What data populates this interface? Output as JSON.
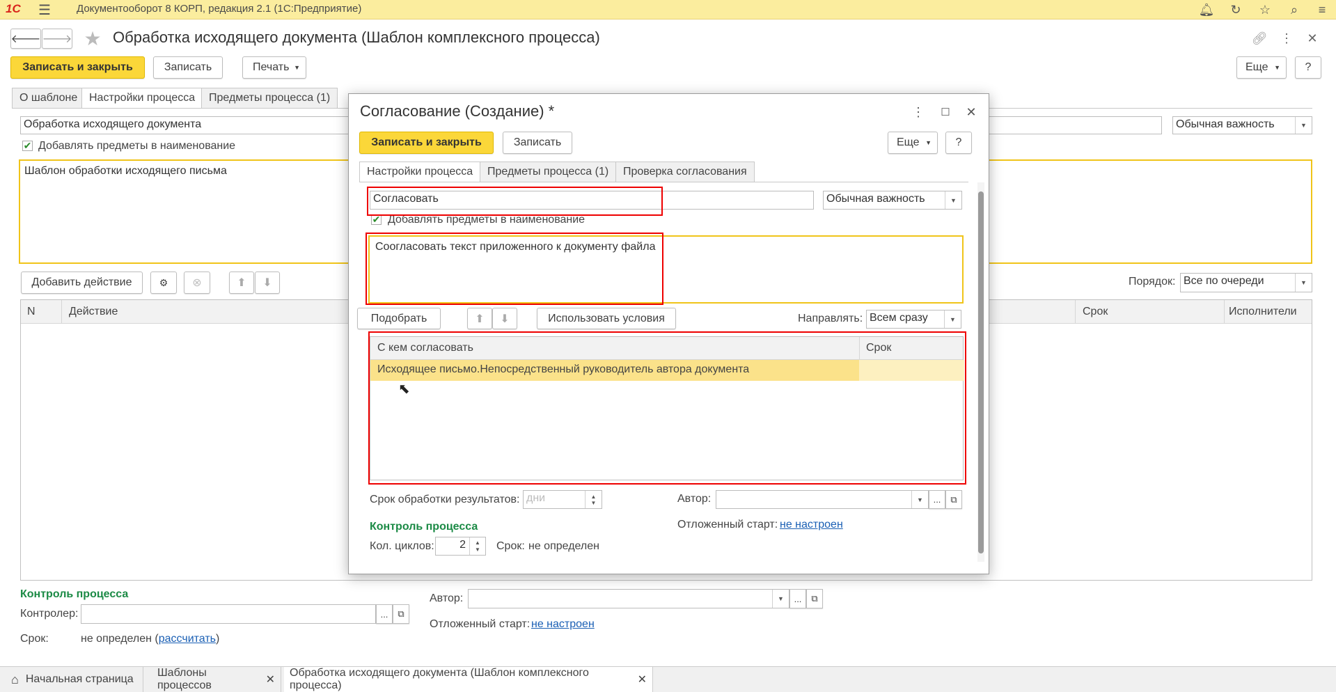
{
  "app": {
    "title": "Документооборот 8 КОРП, редакция 2.1  (1С:Предприятие)",
    "logo": "1С"
  },
  "main": {
    "title": "Обработка исходящего документа (Шаблон комплексного процесса)",
    "btn_save_close": "Записать и закрыть",
    "btn_save": "Записать",
    "btn_print": "Печать",
    "btn_more": "Еще",
    "btn_help": "?",
    "tabs": [
      "О шаблоне",
      "Настройки процесса",
      "Предметы процесса (1)"
    ],
    "name_value": "Обработка исходящего документа",
    "importance": "Обычная важность",
    "add_subjects_label": "Добавлять предметы в наименование",
    "description": "Шаблон обработки исходящего письма",
    "btn_add_action": "Добавить действие",
    "order_label": "Порядок:",
    "order_value": "Все по очереди",
    "table_headers": [
      "N",
      "Действие",
      "Срок",
      "Исполнители"
    ],
    "control_title": "Контроль процесса",
    "controller_label": "Контролер:",
    "term_label": "Срок:",
    "term_value": "не определен (",
    "term_link": "рассчитать",
    "term_close": ")",
    "author_label": "Автор:",
    "delayed_label": "Отложенный старт:",
    "delayed_link": "не настроен"
  },
  "dialog": {
    "title": "Согласование (Создание) *",
    "btn_save_close": "Записать и закрыть",
    "btn_save": "Записать",
    "btn_more": "Еще",
    "btn_help": "?",
    "tabs": [
      "Настройки процесса",
      "Предметы процесса (1)",
      "Проверка согласования"
    ],
    "name_value": "Согласовать",
    "importance": "Обычная важность",
    "add_subjects_label": "Добавлять предметы в наименование",
    "description": "Соогласовать текст приложенного к документу файла",
    "btn_pick": "Подобрать",
    "btn_use_conditions": "Использовать условия",
    "direct_label": "Направлять:",
    "direct_value": "Всем сразу",
    "table_headers": [
      "С кем согласовать",
      "Срок"
    ],
    "rows": [
      {
        "who": "Исходящее письмо.Непосредственный руководитель автора документа",
        "term": ""
      }
    ],
    "processing_label": "Срок обработки результатов:",
    "processing_placeholder": "дни",
    "author_label": "Автор:",
    "delayed_label": "Отложенный старт:",
    "delayed_link": "не настроен",
    "control_title": "Контроль процесса",
    "cycles_label": "Кол. циклов:",
    "cycles_value": "2",
    "term_label": "Срок:",
    "term_value": "не определен"
  },
  "taskbar": {
    "tabs": [
      "Начальная страница",
      "Шаблоны процессов",
      "Обработка исходящего документа (Шаблон комплексного процесса)"
    ]
  }
}
